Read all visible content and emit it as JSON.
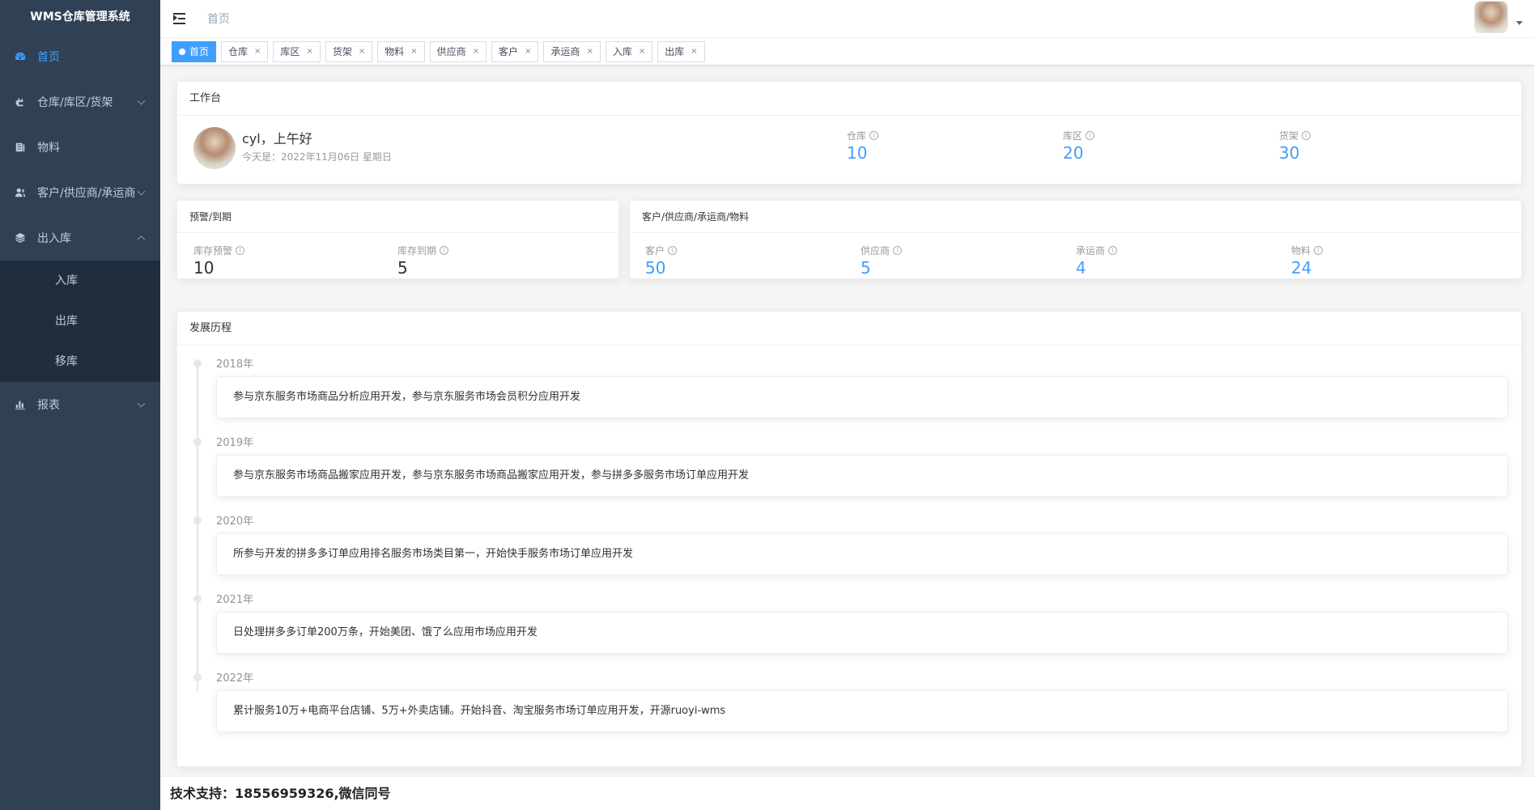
{
  "app": {
    "title": "WMS仓库管理系统"
  },
  "sidebar": {
    "items": [
      {
        "label": "首页",
        "icon": "dashboard-icon",
        "active": true
      },
      {
        "label": "仓库/库区/货架",
        "icon": "warehouse-icon"
      },
      {
        "label": "物料",
        "icon": "material-icon"
      },
      {
        "label": "客户/供应商/承运商",
        "icon": "people-icon"
      },
      {
        "label": "出入库",
        "icon": "layers-icon",
        "expanded": true
      },
      {
        "label": "报表",
        "icon": "bar-chart-icon"
      }
    ],
    "sub_items": [
      "入库",
      "出库",
      "移库"
    ]
  },
  "navbar": {
    "breadcrumb": "首页"
  },
  "tags": [
    {
      "label": "首页",
      "active": true
    },
    {
      "label": "仓库",
      "close": "×"
    },
    {
      "label": "库区",
      "close": "×"
    },
    {
      "label": "货架",
      "close": "×"
    },
    {
      "label": "物料",
      "close": "×"
    },
    {
      "label": "供应商",
      "close": "×"
    },
    {
      "label": "客户",
      "close": "×"
    },
    {
      "label": "承运商",
      "close": "×"
    },
    {
      "label": "入库",
      "close": "×"
    },
    {
      "label": "出库",
      "close": "×"
    }
  ],
  "workbench": {
    "title": "工作台",
    "greeting": "cyl，上午好",
    "date_text": "今天是：2022年11月06日 星期日",
    "stats": [
      {
        "label": "仓库",
        "value": "10"
      },
      {
        "label": "库区",
        "value": "20"
      },
      {
        "label": "货架",
        "value": "30"
      }
    ]
  },
  "warning": {
    "title": "预警/到期",
    "stats": [
      {
        "label": "库存预警",
        "value": "10"
      },
      {
        "label": "库存到期",
        "value": "5"
      }
    ]
  },
  "relations": {
    "title": "客户/供应商/承运商/物料",
    "stats": [
      {
        "label": "客户",
        "value": "50"
      },
      {
        "label": "供应商",
        "value": "5"
      },
      {
        "label": "承运商",
        "value": "4"
      },
      {
        "label": "物料",
        "value": "24"
      }
    ]
  },
  "history": {
    "title": "发展历程",
    "items": [
      {
        "year": "2018年",
        "text": "参与京东服务市场商品分析应用开发，参与京东服务市场会员积分应用开发"
      },
      {
        "year": "2019年",
        "text": "参与京东服务市场商品搬家应用开发，参与京东服务市场商品搬家应用开发，参与拼多多服务市场订单应用开发"
      },
      {
        "year": "2020年",
        "text": "所参与开发的拼多多订单应用排名服务市场类目第一，开始快手服务市场订单应用开发"
      },
      {
        "year": "2021年",
        "text": "日处理拼多多订单200万条，开始美团、饿了么应用市场应用开发"
      },
      {
        "year": "2022年",
        "text": "累计服务10万+电商平台店铺、5万+外卖店铺。开始抖音、淘宝服务市场订单应用开发，开源ruoyi-wms"
      }
    ]
  },
  "footer": {
    "text": "技术支持：18556959326,微信同号"
  },
  "colors": {
    "sidebar_bg": "#304156",
    "submenu_bg": "#1f2d3d",
    "accent": "#409eff"
  }
}
